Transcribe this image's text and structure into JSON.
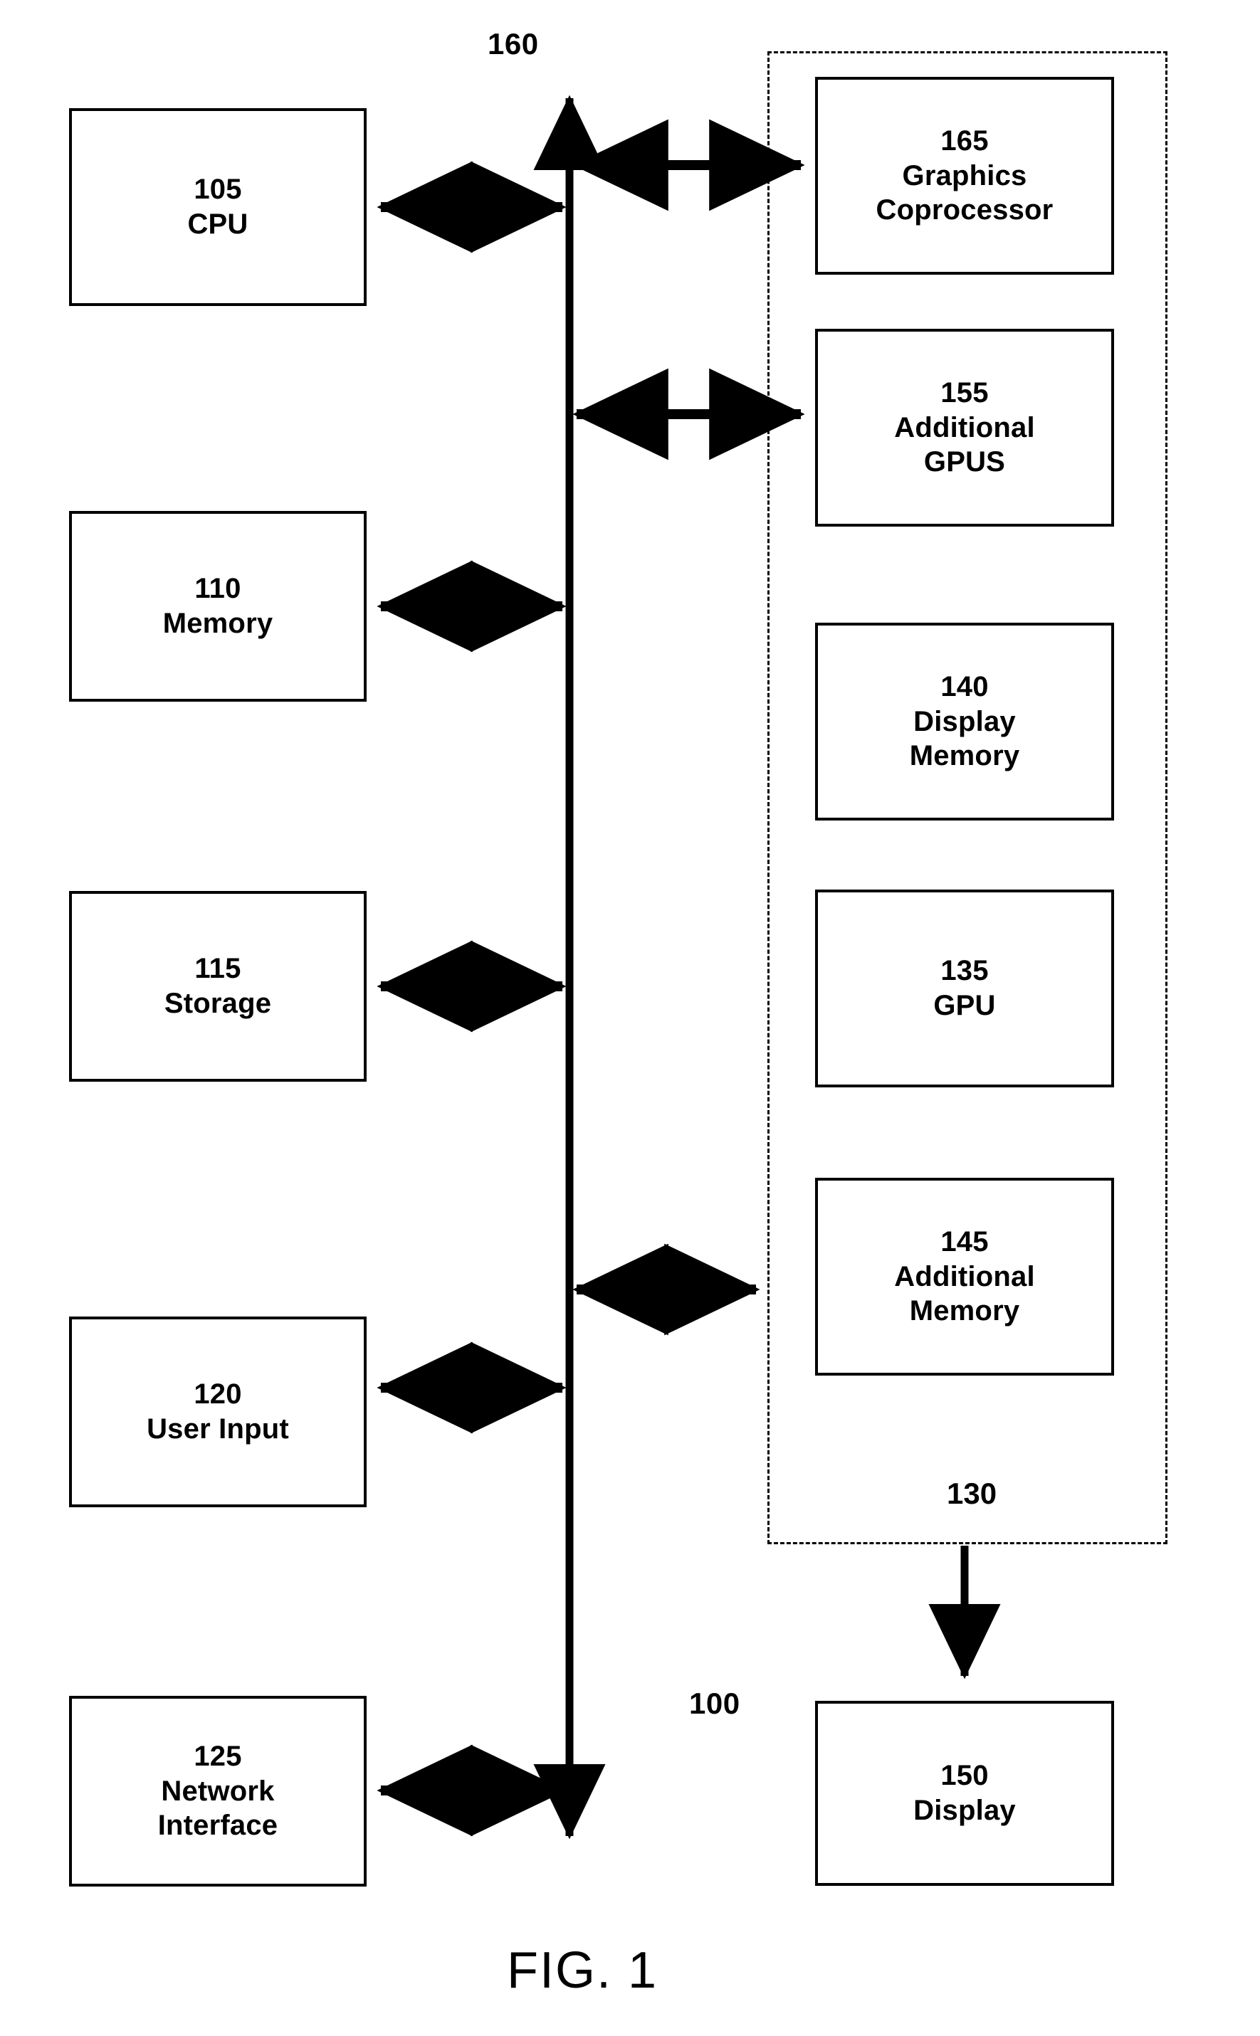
{
  "figure": {
    "caption": "FIG. 1",
    "system_ref": "100",
    "bus_ref": "160",
    "graphics_subsystem_ref": "130"
  },
  "left_column": [
    {
      "ref": "105",
      "name": "CPU"
    },
    {
      "ref": "110",
      "name": "Memory"
    },
    {
      "ref": "115",
      "name": "Storage"
    },
    {
      "ref": "120",
      "name": "User Input"
    },
    {
      "ref": "125",
      "name": "Network\nInterface",
      "name_line1": "Network",
      "name_line2": "Interface"
    }
  ],
  "graphics_subsystem": {
    "ref": "130",
    "boxes": [
      {
        "ref": "165",
        "name_line1": "Graphics",
        "name_line2": "Coprocessor"
      },
      {
        "ref": "155",
        "name_line1": "Additional",
        "name_line2": "GPUS"
      },
      {
        "ref": "140",
        "name_line1": "Display",
        "name_line2": "Memory"
      },
      {
        "ref": "135",
        "name_line1": "GPU",
        "name_line2": ""
      },
      {
        "ref": "145",
        "name_line1": "Additional",
        "name_line2": "Memory"
      }
    ]
  },
  "display": {
    "ref": "150",
    "name": "Display"
  },
  "connections": [
    {
      "from": "105",
      "to": "160",
      "type": "bidirectional"
    },
    {
      "from": "110",
      "to": "160",
      "type": "bidirectional"
    },
    {
      "from": "115",
      "to": "160",
      "type": "bidirectional"
    },
    {
      "from": "120",
      "to": "160",
      "type": "bidirectional"
    },
    {
      "from": "125",
      "to": "160",
      "type": "bidirectional"
    },
    {
      "from": "160",
      "to": "165",
      "type": "bidirectional"
    },
    {
      "from": "160",
      "to": "155",
      "type": "bidirectional"
    },
    {
      "from": "160",
      "to": "130",
      "type": "bidirectional"
    },
    {
      "from": "130",
      "to": "150",
      "type": "directional"
    }
  ],
  "colors": {
    "line": "#000000",
    "background": "#ffffff"
  }
}
